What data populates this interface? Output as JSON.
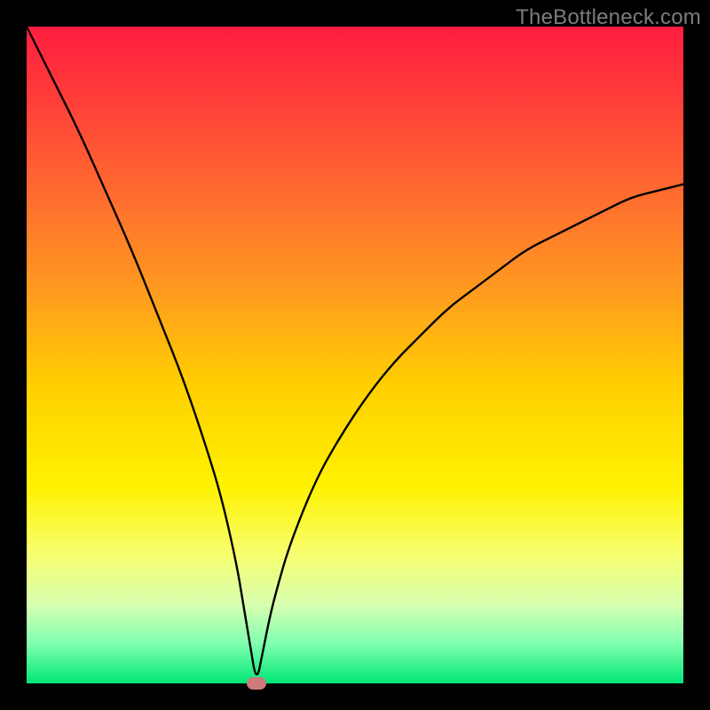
{
  "watermark_text": "TheBottleneck.com",
  "chart_data": {
    "type": "line",
    "title": "",
    "xlabel": "",
    "ylabel": "",
    "xlim": [
      0,
      100
    ],
    "ylim": [
      0,
      100
    ],
    "min_marker": {
      "x": 35,
      "y": 0
    },
    "series": [
      {
        "name": "bottleneck-curve",
        "x": [
          0,
          4,
          8,
          12,
          16,
          20,
          24,
          28,
          30,
          32,
          33,
          34,
          35,
          36,
          37,
          38,
          40,
          44,
          48,
          52,
          56,
          60,
          64,
          68,
          72,
          76,
          80,
          84,
          88,
          92,
          96,
          100
        ],
        "y": [
          100,
          92,
          84,
          75,
          66,
          56,
          46,
          34,
          27,
          18,
          12,
          6,
          0,
          5,
          10,
          14,
          21,
          31,
          38,
          44,
          49,
          53,
          57,
          60,
          63,
          66,
          68,
          70,
          72,
          74,
          75,
          76
        ]
      }
    ]
  }
}
